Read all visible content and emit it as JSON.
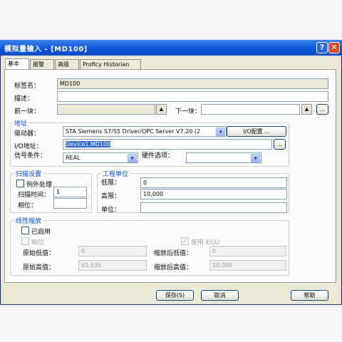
{
  "window": {
    "title": "模拟量输入 - [MD100]",
    "help_glyph": "?",
    "close_glyph": "✕"
  },
  "tabs": [
    {
      "label": "基本",
      "active": true
    },
    {
      "label": "报警",
      "active": false
    },
    {
      "label": "高级",
      "active": false
    },
    {
      "label": "Proficy Historian",
      "active": false
    }
  ],
  "basic": {
    "tag_label": "标签名：",
    "tag_value": "MD100",
    "desc_label": "描述：",
    "desc_value": "",
    "prev_label": "前一块：",
    "prev_value": "",
    "next_label": "下一块：",
    "next_value": "",
    "more": "..."
  },
  "address": {
    "group_title": "地址",
    "driver_label": "驱动器：",
    "driver_value": "STA    Siemens S7/S5 Driver/OPC Server V7.20 (2",
    "io_config_button": "I/O配置 ...",
    "io_label": "I/O地址：",
    "io_value": "Device1.MD100",
    "signal_label": "信号条件：",
    "signal_value": "REAL",
    "hw_label": "硬件选项：",
    "hw_value": ""
  },
  "scan": {
    "group_title": "扫描设置",
    "exception_label": "例外处理",
    "scan_time_label": "扫描时间：",
    "scan_time_value": "1",
    "phase_label": "相位：",
    "phase_value": ""
  },
  "eng": {
    "group_title": "工程单位",
    "low_label": "低限：",
    "low_value": "0",
    "high_label": "高限：",
    "high_value": "10,000",
    "unit_label": "单位：",
    "unit_value": ""
  },
  "scaling": {
    "group_title": "线性缩放",
    "enabled_label": "已启用",
    "phase_label": "相位",
    "use_egu_label": "使用 EGU",
    "raw_low_label": "原始低值：",
    "raw_low_value": "0",
    "raw_high_label": "原始高值：",
    "raw_high_value": "65,535",
    "scaled_low_label": "缩放后低值：",
    "scaled_low_value": "0",
    "scaled_high_label": "缩放后高值：",
    "scaled_high_value": "10,000"
  },
  "footer": {
    "save": "保存(S)",
    "cancel": "取消",
    "help": "帮助"
  },
  "icons": {
    "up": "▲",
    "down": "▼",
    "check": "✓"
  }
}
